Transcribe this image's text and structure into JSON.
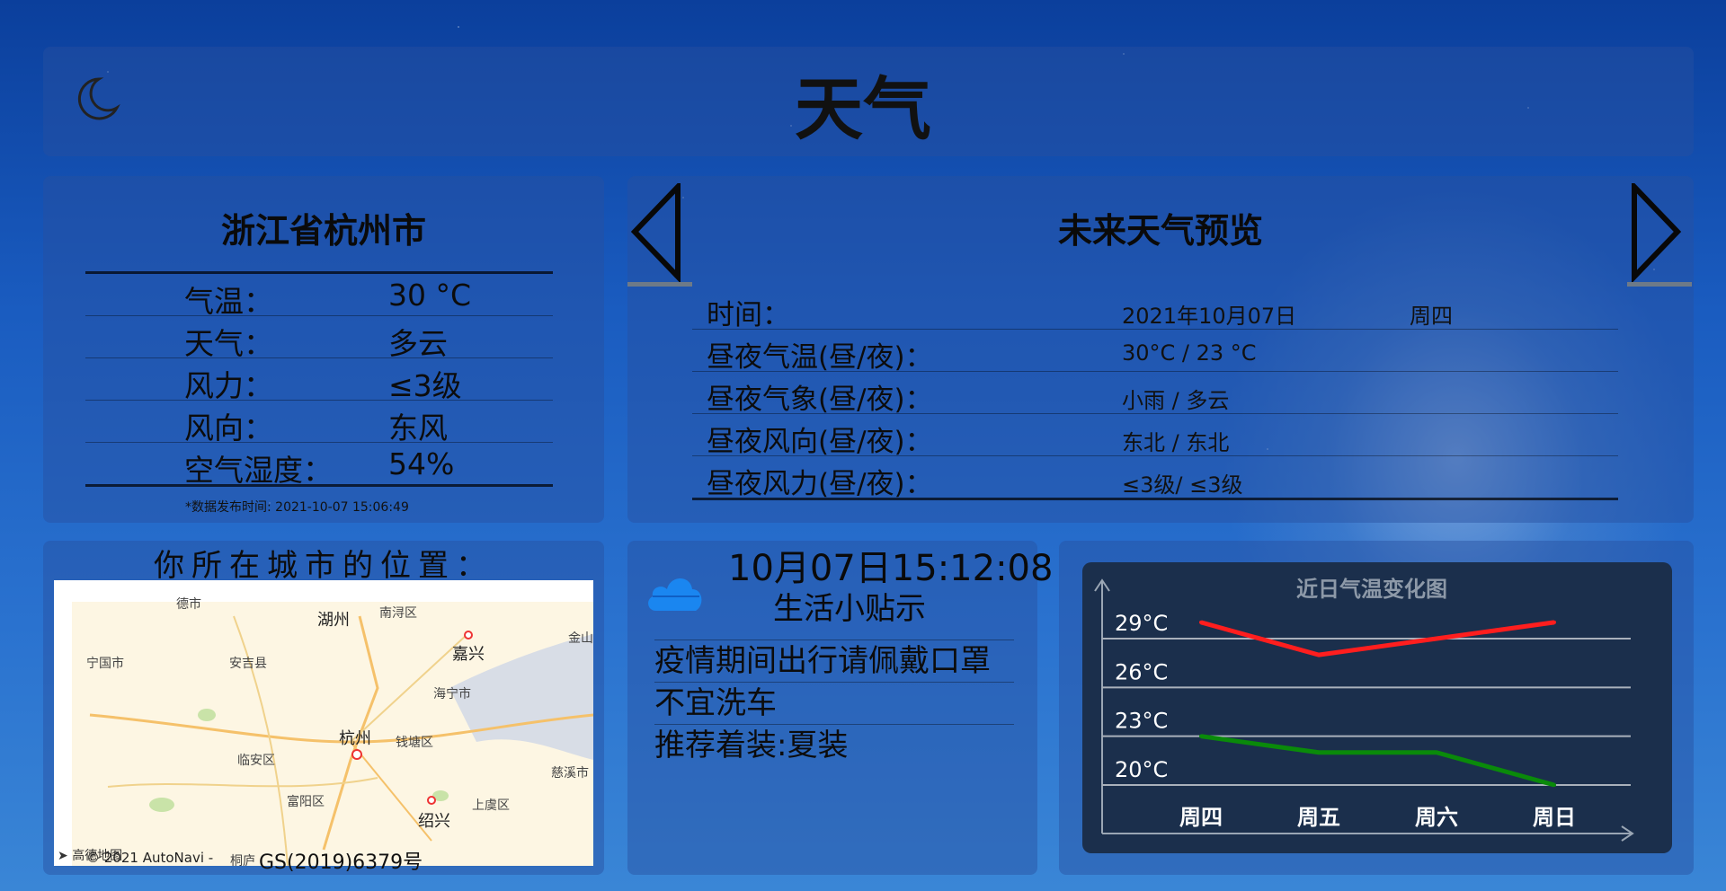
{
  "header": {
    "title": "天气",
    "theme_icon": "moon-icon"
  },
  "current": {
    "location": "浙江省杭州市",
    "rows": [
      {
        "label": "气温：",
        "value": "30 °C"
      },
      {
        "label": "天气：",
        "value": "多云"
      },
      {
        "label": "风力：",
        "value": "≤3级"
      },
      {
        "label": "风向：",
        "value": "东风"
      },
      {
        "label": "空气湿度：",
        "value": "54%"
      }
    ],
    "publish_time": "*数据发布时间: 2021-10-07 15:06:49"
  },
  "forecast": {
    "title": "未来天气预览",
    "prev_icon": "triangle-left-icon",
    "next_icon": "triangle-right-icon",
    "rows": [
      {
        "label": "时间：",
        "value": "2021年10月07日",
        "weekday": "周四"
      },
      {
        "label": "昼夜气温(昼/夜)：",
        "value": "30°C / 23 °C"
      },
      {
        "label": "昼夜气象(昼/夜)：",
        "value": "小雨 / 多云"
      },
      {
        "label": "昼夜风向(昼/夜)：",
        "value": "东北 / 东北"
      },
      {
        "label": "昼夜风力(昼/夜)：",
        "value": "≤3级/ ≤3级"
      }
    ]
  },
  "map": {
    "title": "你所在城市的位置：",
    "places": [
      "德市",
      "湖州",
      "南浔区",
      "嘉兴",
      "金山",
      "宁国市",
      "安吉县",
      "海宁市",
      "杭州",
      "钱塘区",
      "临安区",
      "慈溪市",
      "富阳区",
      "绍兴",
      "上虞区",
      "桐庐"
    ],
    "logo": "高德地图",
    "copyright": "© 2021 AutoNavi -",
    "license": "GS(2019)6379号"
  },
  "tips": {
    "clock": "10月07日15:12:08",
    "title": "生活小贴示",
    "icon": "cloud-icon",
    "items": [
      "疫情期间出行请佩戴口罩",
      "不宜洗车",
      "推荐着装:夏装"
    ]
  },
  "colors": {
    "day_line": "#ff1e1e",
    "night_line": "#0a8a0a",
    "chart_bg": "#1b2f4c"
  },
  "chart_data": {
    "type": "line",
    "title": "近日气温变化图",
    "categories": [
      "周四",
      "周五",
      "周六",
      "周日"
    ],
    "series": [
      {
        "values": [
          30,
          28,
          29,
          30
        ]
      },
      {
        "values": [
          23,
          22,
          22,
          20
        ]
      }
    ],
    "y_ticks": [
      "29°C",
      "26°C",
      "23°C",
      "20°C"
    ],
    "ylim": [
      20,
      29
    ],
    "grid": true
  }
}
